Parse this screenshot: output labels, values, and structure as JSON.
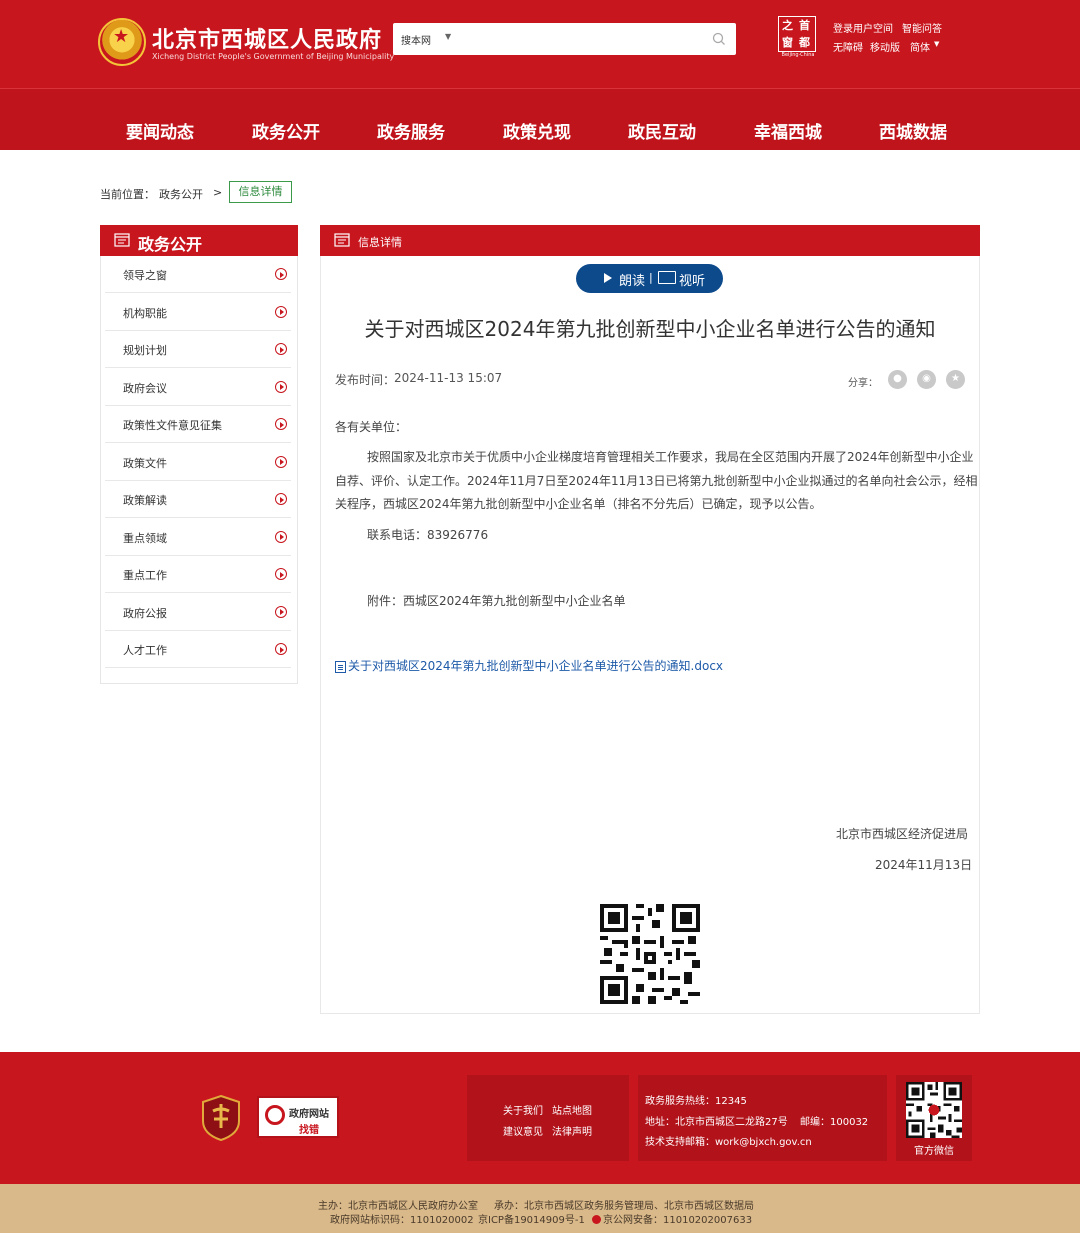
{
  "header": {
    "site_title": "北京市西城区人民政府",
    "site_subtitle": "Xicheng District People's Government of Beijing Municipality",
    "search": {
      "scope": "搜本网",
      "placeholder": ""
    },
    "capital_logo_text": "Beijing·China",
    "links": {
      "login": "登录用户空间",
      "smart_qa": "智能问答",
      "accessibility": "无障碍",
      "mobile": "移动版",
      "simplified": "简体"
    }
  },
  "nav": [
    "要闻动态",
    "政务公开",
    "政务服务",
    "政策兑现",
    "政民互动",
    "幸福西城",
    "西城数据"
  ],
  "breadcrumb": {
    "label": "当前位置：",
    "item": "政务公开",
    "sep": ">",
    "current": "信息详情"
  },
  "sidebar": {
    "title": "政务公开",
    "items": [
      "领导之窗",
      "机构职能",
      "规划计划",
      "政府会议",
      "政策性文件意见征集",
      "政策文件",
      "政策解读",
      "重点领域",
      "重点工作",
      "政府公报",
      "人才工作"
    ]
  },
  "content": {
    "head_title": "信息详情",
    "reader": {
      "read": "朗读",
      "sep": "|",
      "view": "视听"
    },
    "title": "关于对西城区2024年第九批创新型中小企业名单进行公告的通知",
    "publish_label": "发布时间：",
    "publish_time": "2024-11-13 15:07",
    "share_label": "分享：",
    "salutation": "各有关单位：",
    "body_lines": [
      "按照国家及北京市关于优质中小企业梯度培育管理相关工作要求，我局在全区范围内开展了2024年创新型中小企业",
      "自荐、评价、认定工作。2024年11月7日至2024年11月13日已将第九批创新型中小企业拟通过的名单向社会公示，经相",
      "关程序，西城区2024年第九批创新型中小企业名单（排名不分先后）已确定，现予以公告。"
    ],
    "contact": "联系电话：83926776",
    "attachment_note": "附件：西城区2024年第九批创新型中小企业名单",
    "attachment_file": "关于对西城区2024年第九批创新型中小企业名单进行公告的通知.docx",
    "issuer": "北京市西城区经济促进局",
    "issue_date": "2024年11月13日"
  },
  "footer": {
    "gov_error": {
      "title": "政府网站",
      "sub": "找错"
    },
    "links": {
      "about": "关于我们",
      "sitemap": "站点地图",
      "feedback": "建议意见",
      "legal": "法律声明"
    },
    "hotline": "政务服务热线：12345",
    "address": "地址：北京市西城区二龙路27号",
    "postcode": "邮编：100032",
    "email": "技术支持邮箱：work@bjxch.gov.cn",
    "qr_label": "官方微信",
    "sponsor": "主办：北京市西城区人民政府办公室",
    "organizer": "承办：北京市西城区政务服务管理局、北京市西城区数据局",
    "site_id": "政府网站标识码：1101020002",
    "icp": "京ICP备19014909号-1",
    "police": "京公网安备：11010202007633"
  }
}
